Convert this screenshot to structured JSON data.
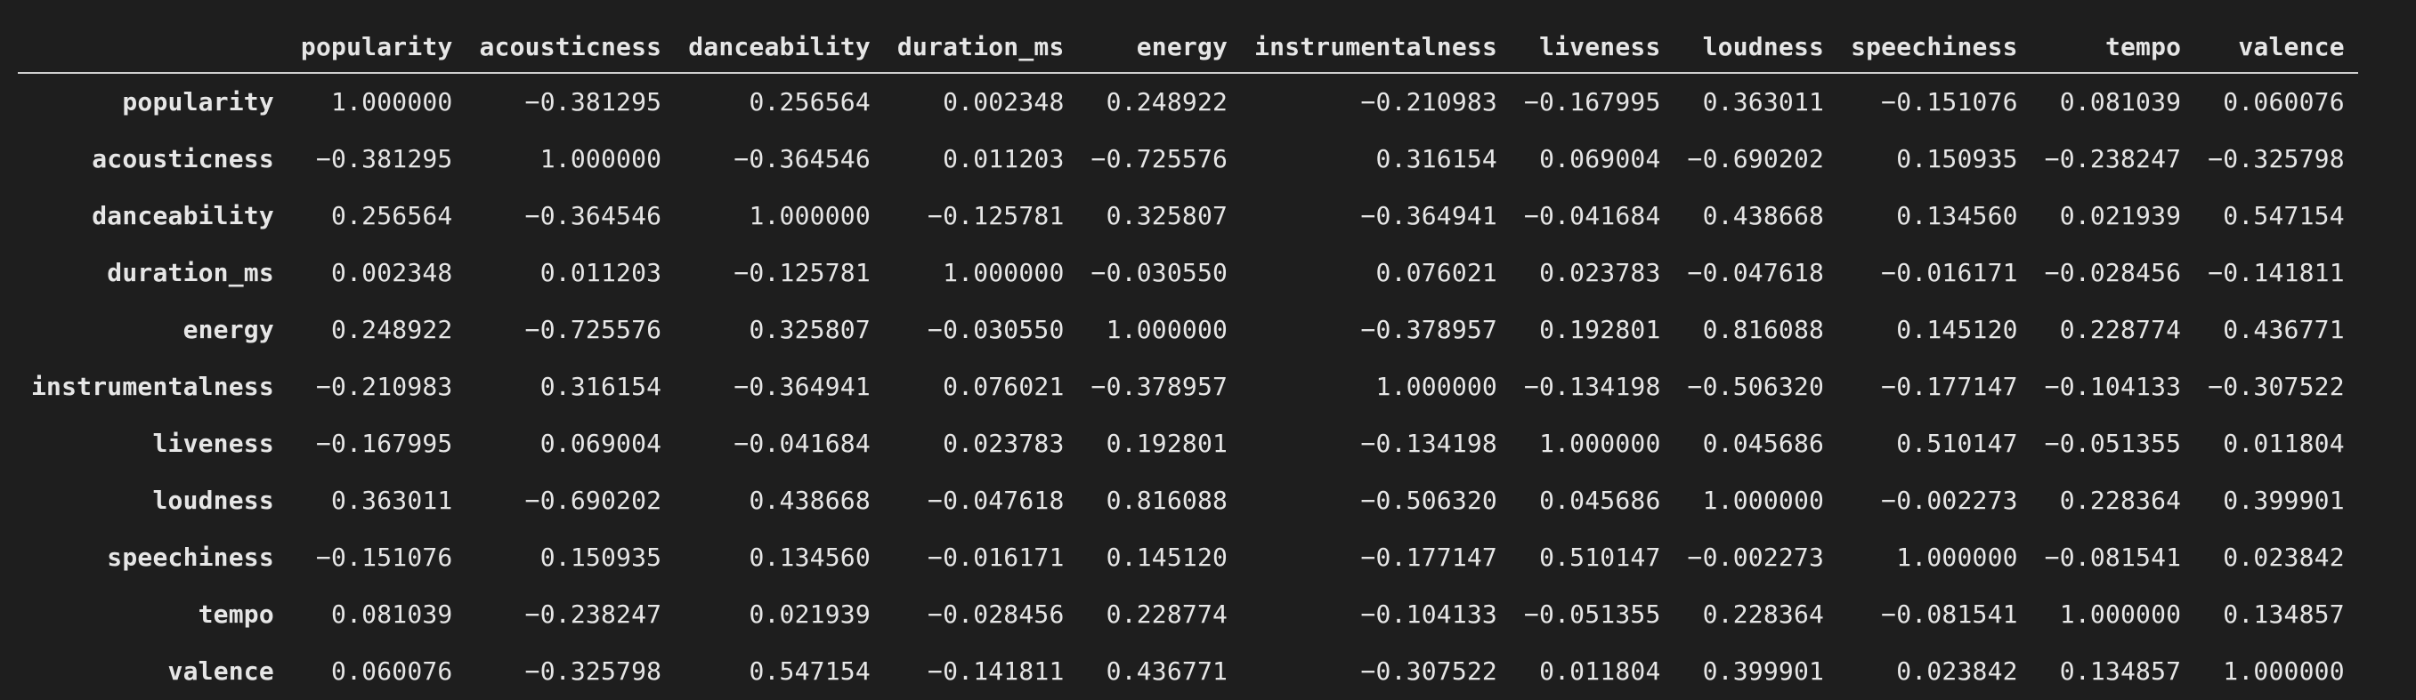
{
  "table": {
    "columns": [
      "popularity",
      "acousticness",
      "danceability",
      "duration_ms",
      "energy",
      "instrumentalness",
      "liveness",
      "loudness",
      "speechiness",
      "tempo",
      "valence"
    ],
    "rows": [
      {
        "index": "popularity",
        "values": [
          "1.000000",
          "−0.381295",
          "0.256564",
          "0.002348",
          "0.248922",
          "−0.210983",
          "−0.167995",
          "0.363011",
          "−0.151076",
          "0.081039",
          "0.060076"
        ]
      },
      {
        "index": "acousticness",
        "values": [
          "−0.381295",
          "1.000000",
          "−0.364546",
          "0.011203",
          "−0.725576",
          "0.316154",
          "0.069004",
          "−0.690202",
          "0.150935",
          "−0.238247",
          "−0.325798"
        ]
      },
      {
        "index": "danceability",
        "values": [
          "0.256564",
          "−0.364546",
          "1.000000",
          "−0.125781",
          "0.325807",
          "−0.364941",
          "−0.041684",
          "0.438668",
          "0.134560",
          "0.021939",
          "0.547154"
        ]
      },
      {
        "index": "duration_ms",
        "values": [
          "0.002348",
          "0.011203",
          "−0.125781",
          "1.000000",
          "−0.030550",
          "0.076021",
          "0.023783",
          "−0.047618",
          "−0.016171",
          "−0.028456",
          "−0.141811"
        ]
      },
      {
        "index": "energy",
        "values": [
          "0.248922",
          "−0.725576",
          "0.325807",
          "−0.030550",
          "1.000000",
          "−0.378957",
          "0.192801",
          "0.816088",
          "0.145120",
          "0.228774",
          "0.436771"
        ]
      },
      {
        "index": "instrumentalness",
        "values": [
          "−0.210983",
          "0.316154",
          "−0.364941",
          "0.076021",
          "−0.378957",
          "1.000000",
          "−0.134198",
          "−0.506320",
          "−0.177147",
          "−0.104133",
          "−0.307522"
        ]
      },
      {
        "index": "liveness",
        "values": [
          "−0.167995",
          "0.069004",
          "−0.041684",
          "0.023783",
          "0.192801",
          "−0.134198",
          "1.000000",
          "0.045686",
          "0.510147",
          "−0.051355",
          "0.011804"
        ]
      },
      {
        "index": "loudness",
        "values": [
          "0.363011",
          "−0.690202",
          "0.438668",
          "−0.047618",
          "0.816088",
          "−0.506320",
          "0.045686",
          "1.000000",
          "−0.002273",
          "0.228364",
          "0.399901"
        ]
      },
      {
        "index": "speechiness",
        "values": [
          "−0.151076",
          "0.150935",
          "0.134560",
          "−0.016171",
          "0.145120",
          "−0.177147",
          "0.510147",
          "−0.002273",
          "1.000000",
          "−0.081541",
          "0.023842"
        ]
      },
      {
        "index": "tempo",
        "values": [
          "0.081039",
          "−0.238247",
          "0.021939",
          "−0.028456",
          "0.228774",
          "−0.104133",
          "−0.051355",
          "0.228364",
          "−0.081541",
          "1.000000",
          "0.134857"
        ]
      },
      {
        "index": "valence",
        "values": [
          "0.060076",
          "−0.325798",
          "0.547154",
          "−0.141811",
          "0.436771",
          "−0.307522",
          "0.011804",
          "0.399901",
          "0.023842",
          "0.134857",
          "1.000000"
        ]
      }
    ]
  }
}
